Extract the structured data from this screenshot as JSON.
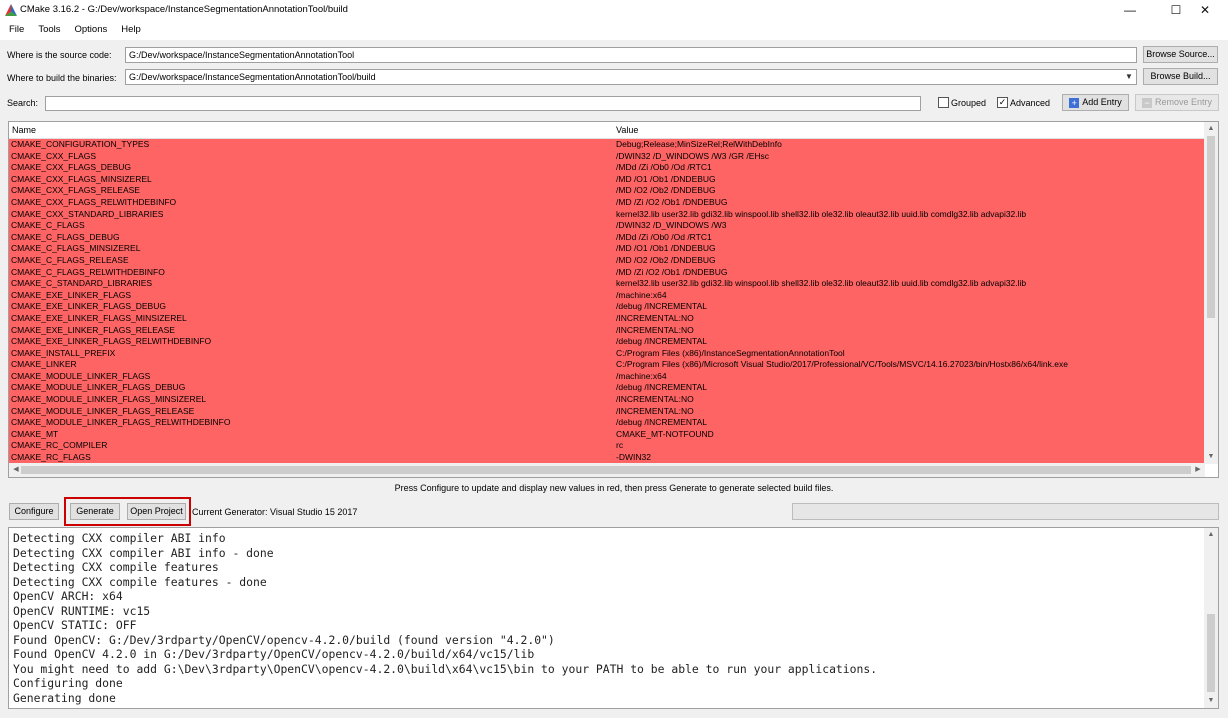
{
  "window": {
    "title": "CMake 3.16.2 - G:/Dev/workspace/InstanceSegmentationAnnotationTool/build",
    "minimize_glyph": "—",
    "maximize_glyph": "☐",
    "close_glyph": "✕"
  },
  "menu": [
    "File",
    "Tools",
    "Options",
    "Help"
  ],
  "source": {
    "label": "Where is the source code:",
    "value": "G:/Dev/workspace/InstanceSegmentationAnnotationTool",
    "browse_label": "Browse Source..."
  },
  "build": {
    "label": "Where to build the binaries:",
    "value": "G:/Dev/workspace/InstanceSegmentationAnnotationTool/build",
    "browse_label": "Browse Build..."
  },
  "search": {
    "label": "Search:",
    "value": "",
    "grouped_label": "Grouped",
    "grouped_checked": false,
    "advanced_label": "Advanced",
    "advanced_checked": true,
    "add_entry_label": "Add Entry",
    "remove_entry_label": "Remove Entry"
  },
  "table": {
    "col_name": "Name",
    "col_value": "Value",
    "row_color": "#ff6464",
    "rows": [
      {
        "name": "CMAKE_CONFIGURATION_TYPES",
        "value": "Debug;Release;MinSizeRel;RelWithDebInfo"
      },
      {
        "name": "CMAKE_CXX_FLAGS",
        "value": "/DWIN32 /D_WINDOWS /W3 /GR /EHsc"
      },
      {
        "name": "CMAKE_CXX_FLAGS_DEBUG",
        "value": "/MDd /Zi /Ob0 /Od /RTC1"
      },
      {
        "name": "CMAKE_CXX_FLAGS_MINSIZEREL",
        "value": "/MD /O1 /Ob1 /DNDEBUG"
      },
      {
        "name": "CMAKE_CXX_FLAGS_RELEASE",
        "value": "/MD /O2 /Ob2 /DNDEBUG"
      },
      {
        "name": "CMAKE_CXX_FLAGS_RELWITHDEBINFO",
        "value": "/MD /Zi /O2 /Ob1 /DNDEBUG"
      },
      {
        "name": "CMAKE_CXX_STANDARD_LIBRARIES",
        "value": "kernel32.lib user32.lib gdi32.lib winspool.lib shell32.lib ole32.lib oleaut32.lib uuid.lib comdlg32.lib advapi32.lib"
      },
      {
        "name": "CMAKE_C_FLAGS",
        "value": "/DWIN32 /D_WINDOWS /W3"
      },
      {
        "name": "CMAKE_C_FLAGS_DEBUG",
        "value": "/MDd /Zi /Ob0 /Od /RTC1"
      },
      {
        "name": "CMAKE_C_FLAGS_MINSIZEREL",
        "value": "/MD /O1 /Ob1 /DNDEBUG"
      },
      {
        "name": "CMAKE_C_FLAGS_RELEASE",
        "value": "/MD /O2 /Ob2 /DNDEBUG"
      },
      {
        "name": "CMAKE_C_FLAGS_RELWITHDEBINFO",
        "value": "/MD /Zi /O2 /Ob1 /DNDEBUG"
      },
      {
        "name": "CMAKE_C_STANDARD_LIBRARIES",
        "value": "kernel32.lib user32.lib gdi32.lib winspool.lib shell32.lib ole32.lib oleaut32.lib uuid.lib comdlg32.lib advapi32.lib"
      },
      {
        "name": "CMAKE_EXE_LINKER_FLAGS",
        "value": "/machine:x64"
      },
      {
        "name": "CMAKE_EXE_LINKER_FLAGS_DEBUG",
        "value": "/debug /INCREMENTAL"
      },
      {
        "name": "CMAKE_EXE_LINKER_FLAGS_MINSIZEREL",
        "value": "/INCREMENTAL:NO"
      },
      {
        "name": "CMAKE_EXE_LINKER_FLAGS_RELEASE",
        "value": "/INCREMENTAL:NO"
      },
      {
        "name": "CMAKE_EXE_LINKER_FLAGS_RELWITHDEBINFO",
        "value": "/debug /INCREMENTAL"
      },
      {
        "name": "CMAKE_INSTALL_PREFIX",
        "value": "C:/Program Files (x86)/InstanceSegmentationAnnotationTool"
      },
      {
        "name": "CMAKE_LINKER",
        "value": "C:/Program Files (x86)/Microsoft Visual Studio/2017/Professional/VC/Tools/MSVC/14.16.27023/bin/Hostx86/x64/link.exe"
      },
      {
        "name": "CMAKE_MODULE_LINKER_FLAGS",
        "value": "/machine:x64"
      },
      {
        "name": "CMAKE_MODULE_LINKER_FLAGS_DEBUG",
        "value": "/debug /INCREMENTAL"
      },
      {
        "name": "CMAKE_MODULE_LINKER_FLAGS_MINSIZEREL",
        "value": "/INCREMENTAL:NO"
      },
      {
        "name": "CMAKE_MODULE_LINKER_FLAGS_RELEASE",
        "value": "/INCREMENTAL:NO"
      },
      {
        "name": "CMAKE_MODULE_LINKER_FLAGS_RELWITHDEBINFO",
        "value": "/debug /INCREMENTAL"
      },
      {
        "name": "CMAKE_MT",
        "value": "CMAKE_MT-NOTFOUND"
      },
      {
        "name": "CMAKE_RC_COMPILER",
        "value": "rc"
      },
      {
        "name": "CMAKE_RC_FLAGS",
        "value": "-DWIN32"
      }
    ]
  },
  "hint": "Press Configure to update and display new values in red, then press Generate to generate selected build files.",
  "actions": {
    "configure_label": "Configure",
    "generate_label": "Generate",
    "open_project_label": "Open Project",
    "generator_text": "Current Generator: Visual Studio 15 2017"
  },
  "output": {
    "lines": [
      "Detecting CXX compiler ABI info",
      "Detecting CXX compiler ABI info - done",
      "Detecting CXX compile features",
      "Detecting CXX compile features - done",
      "OpenCV ARCH: x64",
      "OpenCV RUNTIME: vc15",
      "OpenCV STATIC: OFF",
      "Found OpenCV: G:/Dev/3rdparty/OpenCV/opencv-4.2.0/build (found version \"4.2.0\")",
      "Found OpenCV 4.2.0 in G:/Dev/3rdparty/OpenCV/opencv-4.2.0/build/x64/vc15/lib",
      "You might need to add G:\\Dev\\3rdparty\\OpenCV\\opencv-4.2.0\\build\\x64\\vc15\\bin to your PATH to be able to run your applications.",
      "Configuring done",
      "Generating done"
    ]
  },
  "icons": {
    "app": "cmake-triangle-icon",
    "add": "plus-icon",
    "remove": "minus-icon"
  }
}
